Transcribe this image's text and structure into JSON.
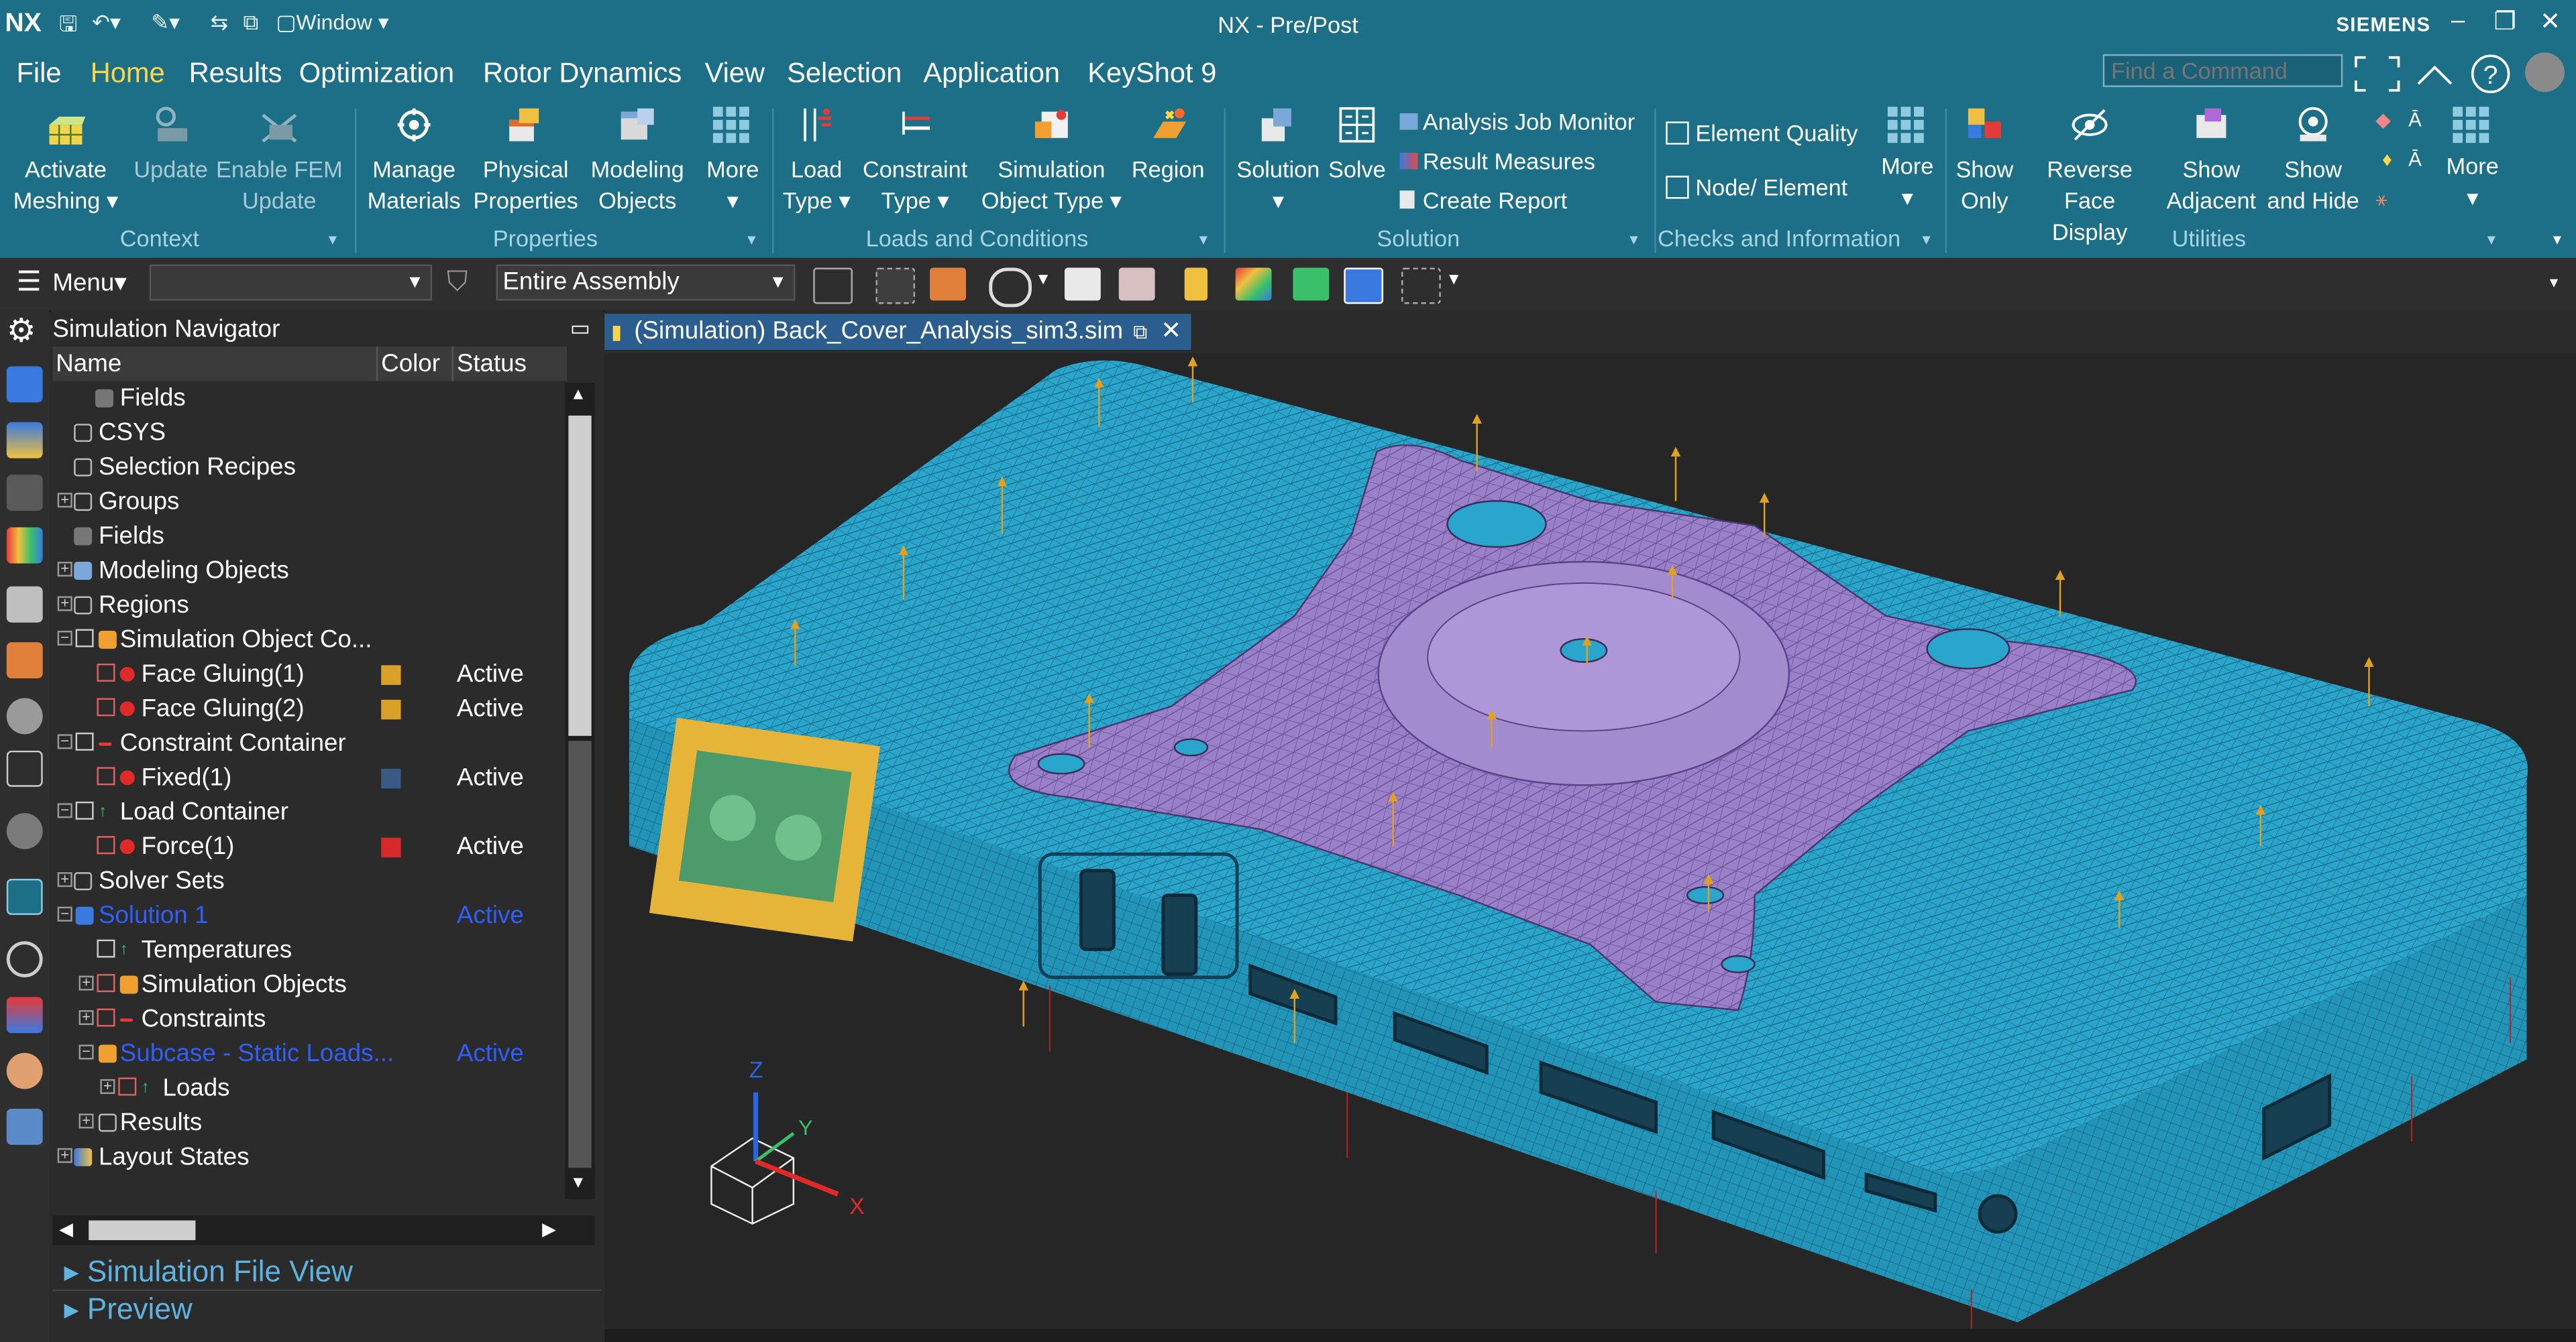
{
  "app": {
    "logo": "NX",
    "window_menu": "Window",
    "title": "NX - Pre/Post",
    "brand": "SIEMENS"
  },
  "menubar": {
    "items": [
      "File",
      "Home",
      "Results",
      "Optimization",
      "Rotor Dynamics",
      "View",
      "Selection",
      "Application",
      "KeyShot 9"
    ],
    "active": "Home",
    "find_placeholder": "Find a Command"
  },
  "ribbon": {
    "context": {
      "group": "Context",
      "activate_meshing": [
        "Activate",
        "Meshing"
      ],
      "update": "Update",
      "enable_fem_update": [
        "Enable FEM",
        "Update"
      ]
    },
    "properties": {
      "group": "Properties",
      "manage_materials": [
        "Manage",
        "Materials"
      ],
      "physical_properties": [
        "Physical",
        "Properties"
      ],
      "modeling_objects": [
        "Modeling",
        "Objects"
      ],
      "more": "More"
    },
    "loads": {
      "group": "Loads and Conditions",
      "load_type": [
        "Load",
        "Type"
      ],
      "constraint_type": [
        "Constraint",
        "Type"
      ],
      "simulation_object_type": [
        "Simulation",
        "Object Type"
      ],
      "region": "Region"
    },
    "solution": {
      "group": "Solution",
      "solution": "Solution",
      "solve": "Solve",
      "analysis_job_monitor": "Analysis Job Monitor",
      "result_measures": "Result Measures",
      "create_report": "Create Report"
    },
    "checks": {
      "group": "Checks and Information",
      "element_quality": "Element Quality",
      "node_element": "Node/ Element",
      "more": "More"
    },
    "utilities": {
      "group": "Utilities",
      "show_only": [
        "Show",
        "Only"
      ],
      "reverse_face_display": [
        "Reverse",
        "Face Display"
      ],
      "show_adjacent": [
        "Show",
        "Adjacent"
      ],
      "show_and_hide": [
        "Show",
        "and Hide"
      ],
      "more": "More"
    }
  },
  "toolbar": {
    "menu": "Menu",
    "filter_value": "",
    "scope": "Entire Assembly"
  },
  "navigator": {
    "title": "Simulation Navigator",
    "columns": [
      "Name",
      "Color",
      "Status"
    ],
    "rows": [
      {
        "label": "Fields",
        "status": ""
      },
      {
        "label": "CSYS",
        "status": ""
      },
      {
        "label": "Selection Recipes",
        "status": ""
      },
      {
        "label": "Groups",
        "status": ""
      },
      {
        "label": "Fields",
        "status": ""
      },
      {
        "label": "Modeling Objects",
        "status": ""
      },
      {
        "label": "Regions",
        "status": ""
      },
      {
        "label": "Simulation Object Co...",
        "status": ""
      },
      {
        "label": "Face Gluing(1)",
        "status": "Active"
      },
      {
        "label": "Face Gluing(2)",
        "status": "Active"
      },
      {
        "label": "Constraint Container",
        "status": ""
      },
      {
        "label": "Fixed(1)",
        "status": "Active"
      },
      {
        "label": "Load Container",
        "status": ""
      },
      {
        "label": "Force(1)",
        "status": "Active"
      },
      {
        "label": "Solver Sets",
        "status": ""
      },
      {
        "label": "Solution 1",
        "status": "Active"
      },
      {
        "label": "Temperatures",
        "status": ""
      },
      {
        "label": "Simulation Objects",
        "status": ""
      },
      {
        "label": "Constraints",
        "status": ""
      },
      {
        "label": "Subcase - Static Loads...",
        "status": "Active"
      },
      {
        "label": "Loads",
        "status": ""
      },
      {
        "label": "Results",
        "status": ""
      },
      {
        "label": "Layout States",
        "status": ""
      }
    ],
    "colors": {
      "face_gluing": "#d9a02a",
      "fixed": "#3a5a86",
      "force": "#d8282a",
      "active_solution": "#2f5fff"
    },
    "panels": [
      "Simulation File View",
      "Preview"
    ]
  },
  "document_tab": {
    "title": "(Simulation) Back_Cover_Analysis_sim3.sim"
  },
  "triad": {
    "x": "X",
    "y": "Y",
    "z": "Z"
  },
  "colors": {
    "chrome": "#1c6f87",
    "mesh": "#2ba3c9",
    "bracket": "#9a80c8",
    "load_arrow": "#e0a020"
  }
}
